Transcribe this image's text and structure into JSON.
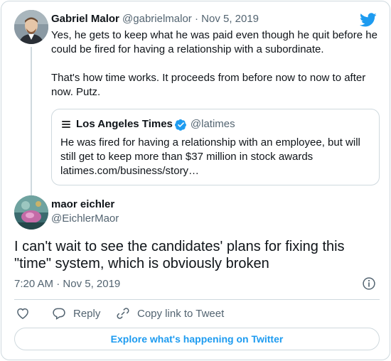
{
  "parent_tweet": {
    "author_name": "Gabriel Malor",
    "author_handle": "@gabrielmalor",
    "separator": "·",
    "date": "Nov 5, 2019",
    "paragraphs": [
      "Yes, he gets to keep what he was paid even though he quit before he could be fired for having a relationship with a subordinate.",
      "That's how time works. It proceeds from before now to now to after now. Putz."
    ],
    "icon": "twitter-bird-icon"
  },
  "quoted_tweet": {
    "author_name": "Los Angeles Times",
    "author_handle": "@latimes",
    "verified": true,
    "text": "He was fired for having a relationship with an employee, but will still get to keep more than $37 million in stock awards",
    "link": "latimes.com/business/story…"
  },
  "main_tweet": {
    "author_name": "maor eichler",
    "author_handle": "@EichlerMaor",
    "text": "I can't wait to see the candidates' plans for fixing this \"time\" system, which is obviously broken",
    "time": "7:20 AM",
    "separator": "·",
    "date": "Nov 5, 2019"
  },
  "actions": {
    "reply_label": "Reply",
    "copy_link_label": "Copy link to Tweet"
  },
  "footer": {
    "explore_label": "Explore what's happening on Twitter"
  },
  "colors": {
    "accent": "#1d9bf0",
    "muted_text": "#536471",
    "border": "#cfd9de",
    "primary_text": "#0f1419"
  }
}
